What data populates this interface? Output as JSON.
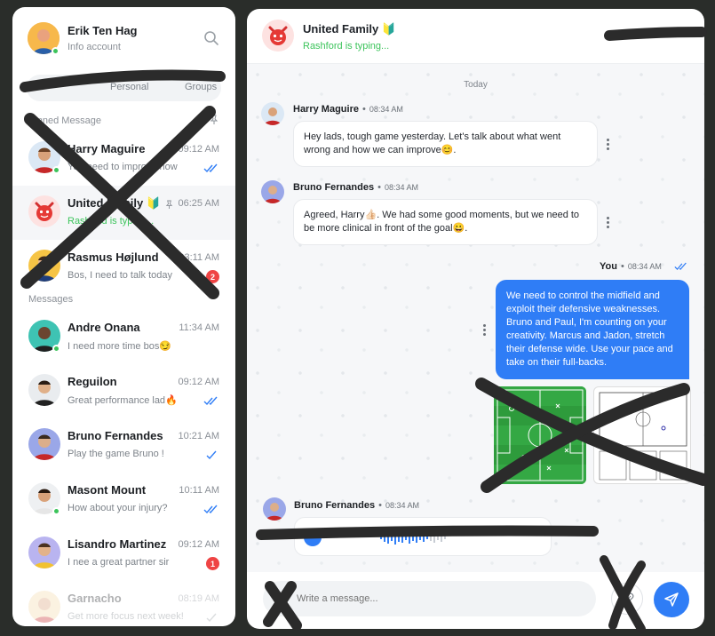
{
  "profile": {
    "name": "Erik Ten Hag",
    "subtitle": "Info account"
  },
  "tabs": {
    "personal": "Personal",
    "groups": "Groups"
  },
  "sections": {
    "pinned": "Pinned Message",
    "messages": "Messages"
  },
  "pinned_chats": [
    {
      "name": "Harry Maguire",
      "preview": "You need to improve how",
      "time": "09:12 AM",
      "status": "read"
    },
    {
      "name": "United Family 🔰",
      "preview": "Rashford is typing...",
      "time": "06:25 AM",
      "status": "typing"
    },
    {
      "name": "Rasmus Højlund",
      "preview": "Bos, I need to talk today",
      "time": "03:11 AM",
      "unread": "2"
    }
  ],
  "chats": [
    {
      "name": "Andre Onana",
      "preview": "I need more time bos😏",
      "time": "11:34 AM"
    },
    {
      "name": "Reguilon",
      "preview": "Great performance lad🔥",
      "time": "09:12 AM",
      "status": "read"
    },
    {
      "name": "Bruno Fernandes",
      "preview": "Play the game Bruno !",
      "time": "10:21 AM",
      "status": "sent"
    },
    {
      "name": "Masont Mount",
      "preview": "How about your injury?",
      "time": "10:11 AM",
      "status": "read"
    },
    {
      "name": "Lisandro Martinez",
      "preview": "I nee a great partner sir",
      "time": "09:12 AM",
      "unread": "1"
    },
    {
      "name": "Garnacho",
      "preview": "Get more focus next week!",
      "time": "08:19 AM",
      "status": "sent"
    }
  ],
  "conversation": {
    "title": "United Family 🔰",
    "status": "Rashford is typing...",
    "day": "Today",
    "separator": "•",
    "messages": [
      {
        "sender": "Harry Maguire",
        "time": "08:34 AM",
        "text": "Hey lads, tough game yesterday. Let's talk about what went wrong and how we can improve😊."
      },
      {
        "sender": "Bruno Fernandes",
        "time": "08:34 AM",
        "text": "Agreed, Harry👍🏻. We had some good moments, but we need to be more clinical in front of the goal😀."
      },
      {
        "sender": "You",
        "time": "08:34 AM",
        "text": "We need to control the midfield and exploit their defensive weaknesses. Bruno and Paul, I'm counting on your creativity. Marcus and Jadon, stretch their defense wide. Use your pace and take on their full-backs."
      },
      {
        "sender": "Bruno Fernandes",
        "time": "08:34 AM",
        "text": ""
      }
    ]
  },
  "composer": {
    "placeholder": "Write a message..."
  },
  "colors": {
    "accent": "#2f7df6",
    "online": "#3cc45b",
    "unread": "#ef4444",
    "pitch": "#2e9b3c"
  },
  "icons": {
    "search": "search-icon",
    "pin": "pin-icon",
    "read": "double-check-icon",
    "sent": "check-icon",
    "send": "send-icon",
    "attach": "paperclip-icon",
    "emoji": "emoji-icon",
    "more": "kebab-icon",
    "play": "play-icon"
  }
}
